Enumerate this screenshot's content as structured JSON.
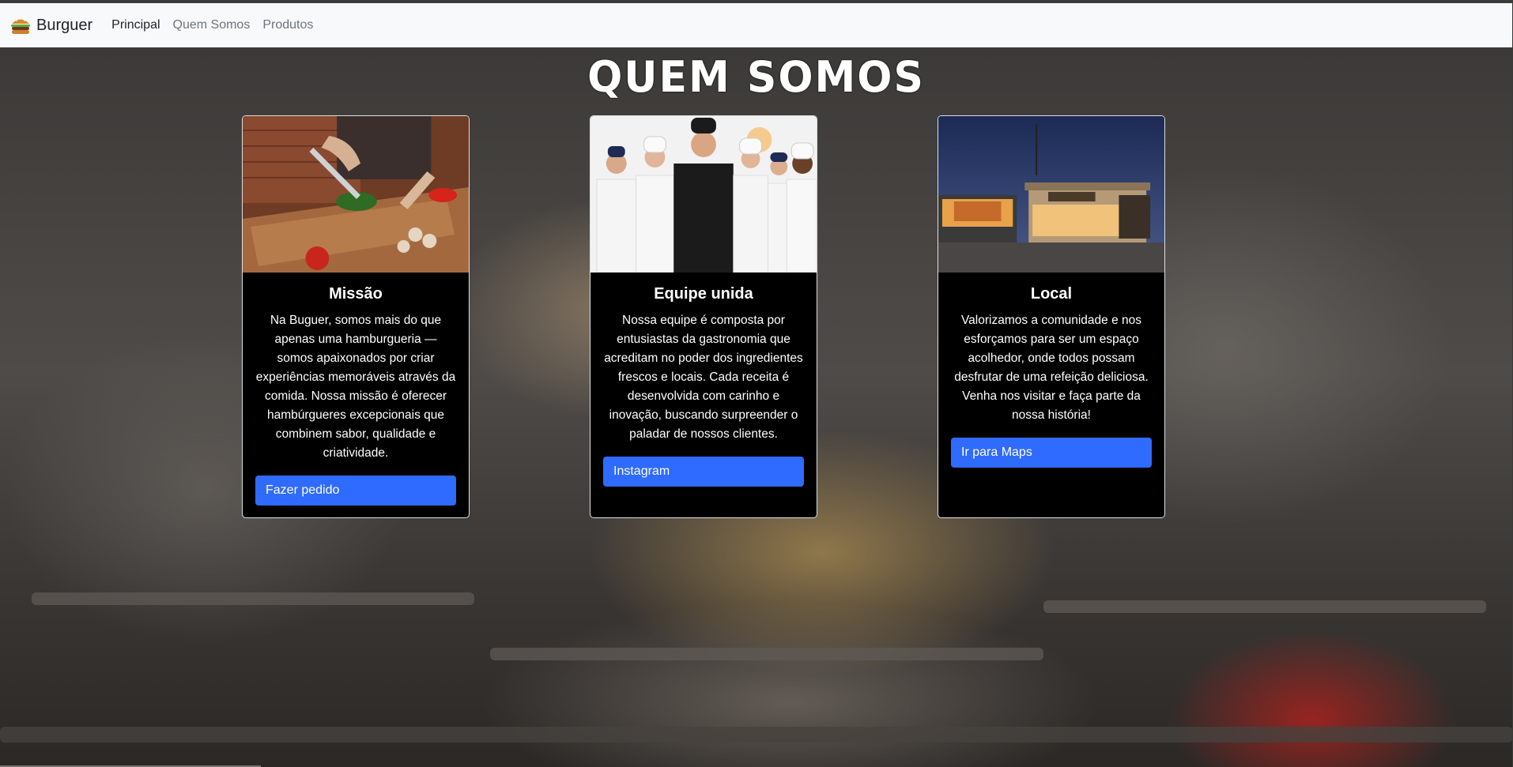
{
  "navbar": {
    "brand": "Burguer",
    "links": [
      "Principal",
      "Quem Somos",
      "Produtos"
    ]
  },
  "page": {
    "title": "QUEM SOMOS"
  },
  "cards": [
    {
      "title": "Missão",
      "text": "Na Buguer, somos mais do que apenas uma hamburgueria — somos apaixonados por criar experiências memoráveis através da comida. Nossa missão é oferecer hambúrgueres excepcionais que combinem sabor, qualidade e criatividade.",
      "button": "Fazer pedido"
    },
    {
      "title": "Equipe unida",
      "text": "Nossa equipe é composta por entusiastas da gastronomia que acreditam no poder dos ingredientes frescos e locais. Cada receita é desenvolvida com carinho e inovação, buscando surpreender o paladar de nossos clientes.",
      "button": "Instagram"
    },
    {
      "title": "Local",
      "text": "Valorizamos a comunidade e nos esforçamos para ser um espaço acolhedor, onde todos possam desfrutar de uma refeição deliciosa. Venha nos visitar e faça parte da nossa história!",
      "button": "Ir para Maps"
    }
  ],
  "colors": {
    "primary_button": "#2f6bff",
    "card_bg": "#000000",
    "navbar_bg": "#f8f9fa"
  }
}
